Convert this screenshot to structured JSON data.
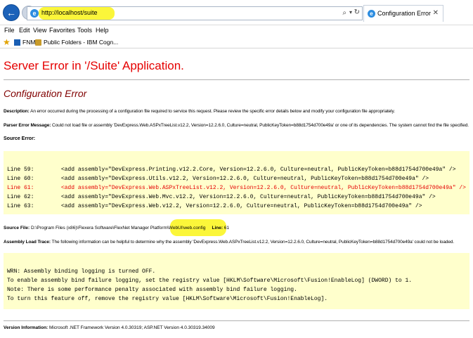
{
  "browser": {
    "url": "http://localhost/suite",
    "tab_title": "Configuration Error",
    "search_glyph": "⌕",
    "dropdown_glyph": "▾",
    "refresh_glyph": "↻",
    "close_glyph": "✕",
    "back_glyph": "←",
    "forward_glyph": "→",
    "icons": [
      "back-arrow-icon",
      "forward-arrow-icon",
      "ie-page-icon",
      "search-icon",
      "refresh-icon",
      "close-icon",
      "favorites-star-icon"
    ]
  },
  "menu": [
    "File",
    "Edit",
    "View",
    "Favorites",
    "Tools",
    "Help"
  ],
  "favorites": [
    {
      "label": "FNMS"
    },
    {
      "label": "Public Folders - IBM Cogn..."
    }
  ],
  "page": {
    "title": "Server Error in '/Suite' Application.",
    "subtitle": "Configuration Error",
    "description_label": "Description:",
    "description_text": " An error occurred during the processing of a configuration file required to service this request. Please review the specific error details below and modify your configuration file appropriately.",
    "parser_label": "Parser Error Message:",
    "parser_text": " Could not load file or assembly 'DevExpress.Web.ASPxTreeList.v12.2, Version=12.2.6.0, Culture=neutral, PublicKeyToken=b88d1754d700e49a' or one of its dependencies. The system cannot find the file specified.",
    "source_error_label": "Source Error:",
    "source_lines": [
      {
        "text": "Line 59:        <add assembly=\"DevExpress.Printing.v12.2.Core, Version=12.2.6.0, Culture=neutral, PublicKeyToken=b88d1754d700e49a\" />",
        "error": false
      },
      {
        "text": "Line 60:        <add assembly=\"DevExpress.Utils.v12.2, Version=12.2.6.0, Culture=neutral, PublicKeyToken=b88d1754d700e49a\" />",
        "error": false
      },
      {
        "text": "Line 61:        <add assembly=\"DevExpress.Web.ASPxTreeList.v12.2, Version=12.2.6.0, Culture=neutral, PublicKeyToken=b88d1754d700e49a\" />",
        "error": true
      },
      {
        "text": "Line 62:        <add assembly=\"DevExpress.Web.Mvc.v12.2, Version=12.2.6.0, Culture=neutral, PublicKeyToken=b88d1754d700e49a\" />",
        "error": false
      },
      {
        "text": "Line 63:        <add assembly=\"DevExpress.Web.v12.2, Version=12.2.6.0, Culture=neutral, PublicKeyToken=b88d1754d700e49a\" />",
        "error": false
      }
    ],
    "source_file_label": "Source File:",
    "source_file_path": " D:\\Program Files (x86)\\Flexera Software\\FlexNet Manager Platform\\WebUI\\web.config",
    "line_label": "Line:",
    "line_value": " 61",
    "trace_label": "Assembly Load Trace:",
    "trace_text": " The following information can be helpful to determine why the assembly 'DevExpress.Web.ASPxTreeList.v12.2, Version=12.2.6.0, Culture=neutral, PublicKeyToken=b88d1754d700e49a' could not be loaded.",
    "trace_lines": [
      "WRN: Assembly binding logging is turned OFF.",
      "To enable assembly bind failure logging, set the registry value [HKLM\\Software\\Microsoft\\Fusion!EnableLog] (DWORD) to 1.",
      "Note: There is some performance penalty associated with assembly bind failure logging.",
      "To turn this feature off, remove the registry value [HKLM\\Software\\Microsoft\\Fusion!EnableLog]."
    ],
    "version_label": "Version Information:",
    "version_text": " Microsoft .NET Framework Version 4.0.30319; ASP.NET Version 4.0.30319.34009"
  },
  "colors": {
    "error_red": "#e50000",
    "subtitle_maroon": "#800000",
    "code_background": "#ffffcc",
    "highlight_yellow": "#fbf63a"
  }
}
